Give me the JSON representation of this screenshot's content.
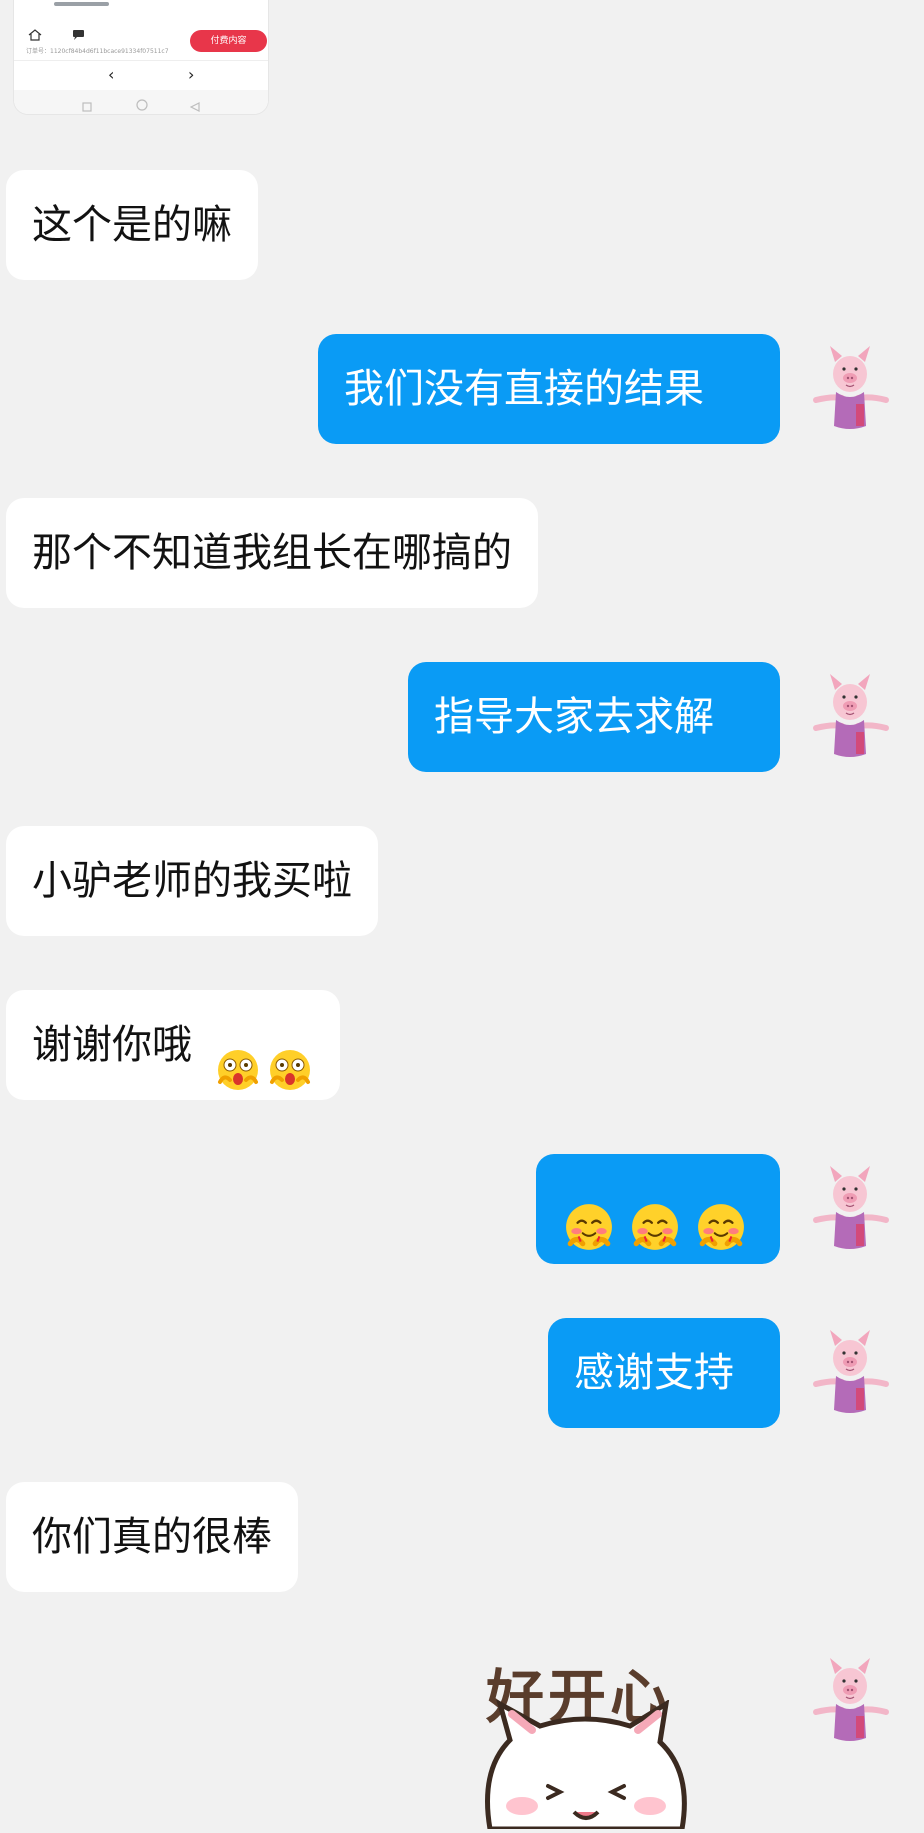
{
  "thumbnail": {
    "order_label": "订单号：",
    "order_number": "1120cf84b4d6f11bcace91334f07511c7",
    "pay_button": "付费内容",
    "prev_arrow": "‹",
    "next_arrow": "›"
  },
  "messages": [
    {
      "side": "in",
      "text": "这个是的嘛"
    },
    {
      "side": "out",
      "text": "我们没有直接的结果"
    },
    {
      "side": "in",
      "text": "那个不知道我组长在哪搞的"
    },
    {
      "side": "out",
      "text": "指导大家去求解"
    },
    {
      "side": "in",
      "text": "小驴老师的我买啦"
    },
    {
      "side": "in",
      "text": "谢谢你哦",
      "emoji": "shocked-emoji ×2"
    },
    {
      "side": "out",
      "text": "",
      "emoji": "shy-smile-emoji ×3"
    },
    {
      "side": "out",
      "text": "感谢支持"
    },
    {
      "side": "in",
      "text": "你们真的很棒"
    },
    {
      "side": "out",
      "sticker": "cat-sticker",
      "sticker_text": "好开心"
    }
  ],
  "colors": {
    "background": "#f1f1f1",
    "incoming_bubble": "#ffffff",
    "outgoing_bubble": "#0a9bf5",
    "pay_button": "#e8364a"
  },
  "icons": [
    "home-icon",
    "chat-icon",
    "square-nav-icon",
    "circle-nav-icon",
    "triangle-back-icon",
    "piglet-avatar-icon",
    "shocked-emoji-icon",
    "shy-smile-emoji-icon"
  ]
}
